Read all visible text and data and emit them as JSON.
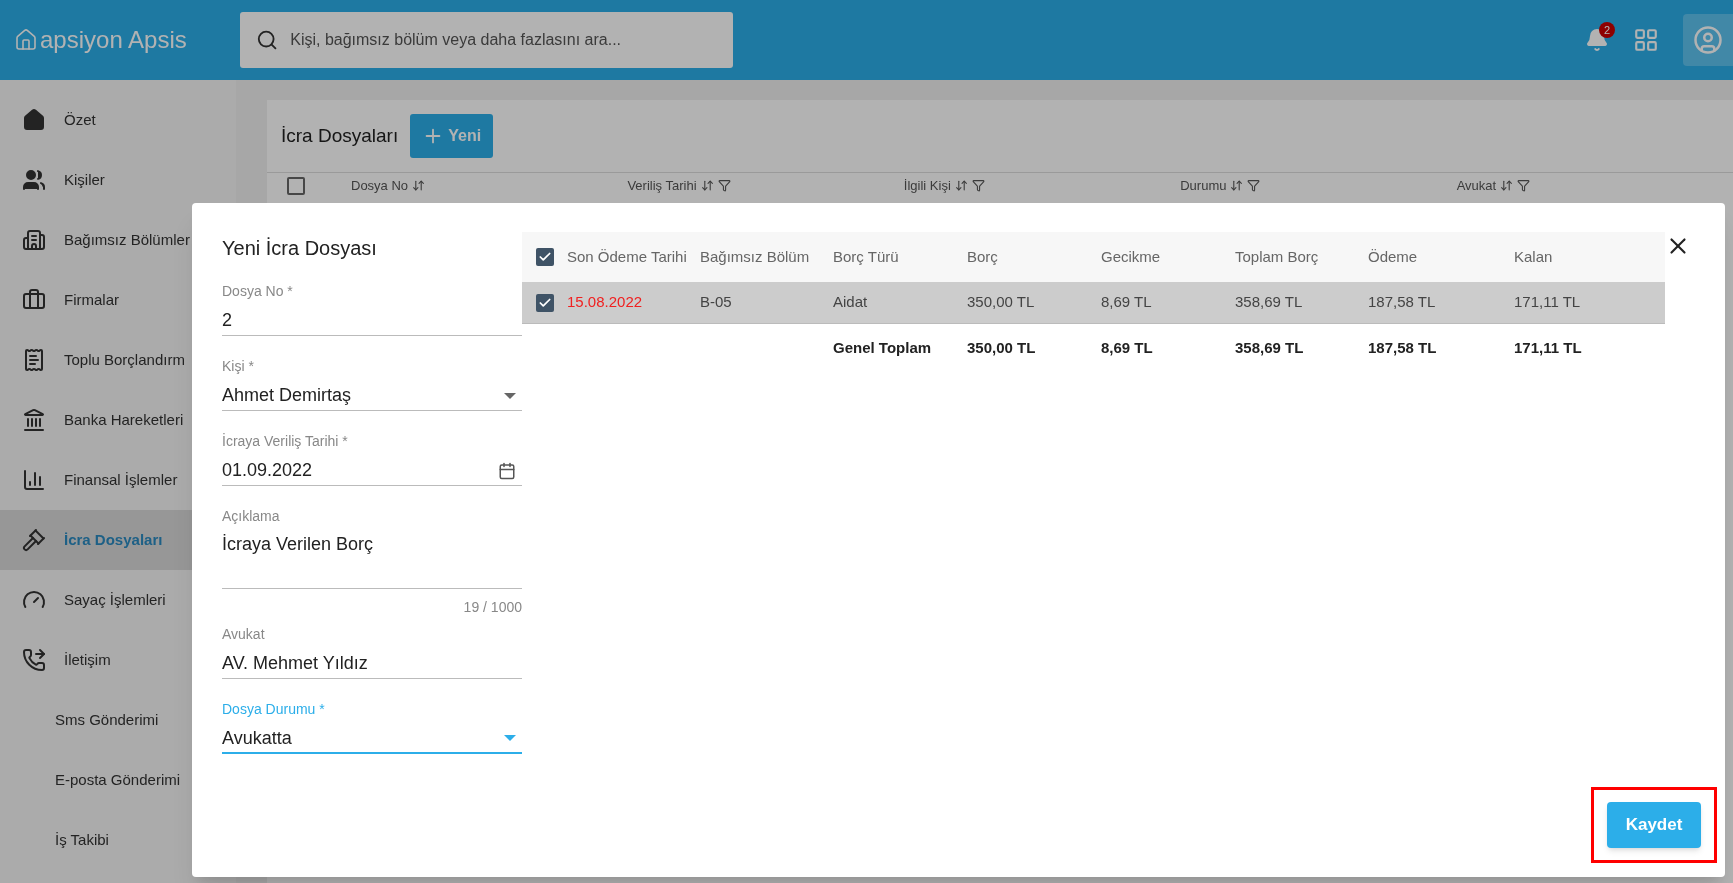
{
  "app": {
    "logo": "apsiyon Apsis",
    "search": {
      "placeholder": "Kişi, bağımsız bölüm veya daha fazlasını ara..."
    },
    "notifications": {
      "badge": "2"
    }
  },
  "sidebar": {
    "items": [
      {
        "label": "Özet",
        "selected": false,
        "kind": "home"
      },
      {
        "label": "Kişiler",
        "selected": false,
        "kind": "people"
      },
      {
        "label": "Bağımsız Bölümler",
        "selected": false,
        "kind": "building"
      },
      {
        "label": "Firmalar",
        "selected": false,
        "kind": "briefcase"
      },
      {
        "label": "Toplu Borçlandırm",
        "selected": false,
        "kind": "receipt"
      },
      {
        "label": "Banka Hareketleri",
        "selected": false,
        "kind": "bank"
      },
      {
        "label": "Finansal İşlemler",
        "selected": false,
        "kind": "chart"
      },
      {
        "label": "İcra Dosyaları",
        "selected": true,
        "kind": "gavel"
      },
      {
        "label": "Sayaç İşlemleri",
        "selected": false,
        "kind": "meter"
      },
      {
        "label": "İletişim",
        "selected": false,
        "kind": "phone"
      },
      {
        "label": "Sms Gönderimi",
        "selected": false,
        "kind": "sub"
      },
      {
        "label": "E-posta Gönderimi",
        "selected": false,
        "kind": "sub"
      },
      {
        "label": "İş Takibi",
        "selected": false,
        "kind": "sub"
      }
    ]
  },
  "page": {
    "title": "İcra Dosyaları",
    "new_button": "Yeni",
    "all_checked": false,
    "columns": [
      "Dosya No",
      "Veriliş Tarihi",
      "İlgili Kişi",
      "Durumu",
      "Avukat"
    ]
  },
  "dialog": {
    "title": "Yeni İcra Dosyası",
    "fields": [
      {
        "label": "Dosya No *",
        "value": "2",
        "kind": "text",
        "focused": false
      },
      {
        "label": "Kişi *",
        "value": "Ahmet Demirtaş",
        "kind": "select",
        "focused": false
      },
      {
        "label": "İcraya Veriliş Tarihi *",
        "value": "01.09.2022",
        "kind": "date",
        "focused": false
      },
      {
        "label": "Açıklama",
        "value": "İcraya Verilen Borç",
        "kind": "textarea",
        "counter": "19 / 1000",
        "focused": false
      },
      {
        "label": "Avukat",
        "value": "AV. Mehmet Yıldız",
        "kind": "text",
        "focused": false
      },
      {
        "label": "Dosya Durumu *",
        "value": "Avukatta",
        "kind": "select",
        "focused": true
      }
    ],
    "table": {
      "all_checked": true,
      "columns": [
        "Son Ödeme Tarihi",
        "Bağımsız Bölüm",
        "Borç Türü",
        "Borç",
        "Gecikme",
        "Toplam Borç",
        "Ödeme",
        "Kalan"
      ],
      "rows": [
        {
          "checked": true,
          "overdue": true,
          "cells": [
            "15.08.2022",
            "B-05",
            "Aidat",
            "350,00 TL",
            "8,69 TL",
            "358,69 TL",
            "187,58 TL",
            "171,11 TL"
          ]
        }
      ],
      "totals": {
        "label": "Genel Toplam",
        "cells": [
          "350,00 TL",
          "8,69 TL",
          "358,69 TL",
          "187,58 TL",
          "171,11 TL"
        ]
      }
    },
    "save_button": {
      "label": "Kaydet",
      "highlighted": true
    }
  }
}
